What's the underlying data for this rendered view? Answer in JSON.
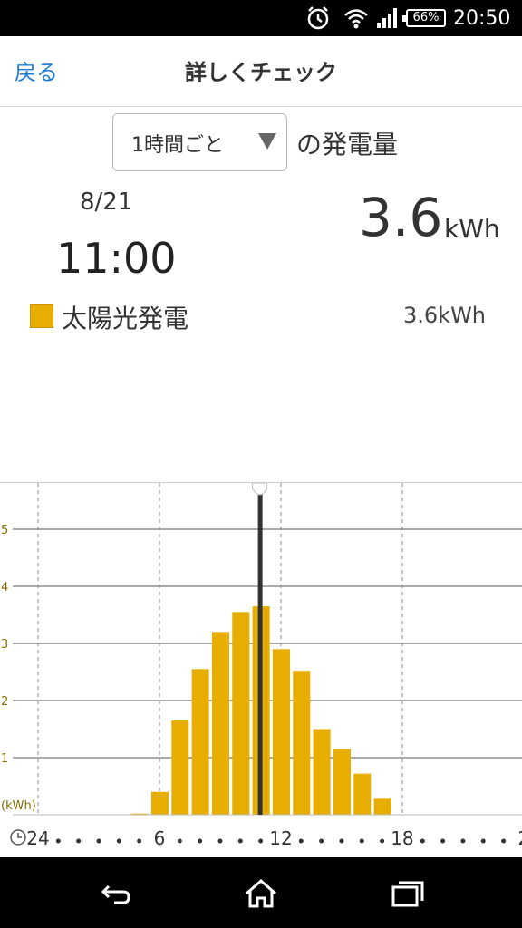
{
  "status_bar": {
    "clock": "20:50",
    "battery": "66%",
    "icons": [
      "alarm-icon",
      "wifi-icon",
      "signal-icon",
      "battery-icon"
    ]
  },
  "app_bar": {
    "back_label": "戻る",
    "title": "詳しくチェック"
  },
  "selector": {
    "selected": "1時間ごと",
    "suffix": "の発電量"
  },
  "summary": {
    "date": "8/21",
    "time": "11:00",
    "total_value": "3.6",
    "total_unit": "kWh",
    "legend_label": "太陽光発電",
    "legend_value": "3.6kWh"
  },
  "colors": {
    "accent": "#1f7ad6",
    "bar": "#e7ad00",
    "ytick": "#8a6d00"
  },
  "chart_data": {
    "type": "bar",
    "ylabel": "(kWh)",
    "ylim": [
      0,
      5.5
    ],
    "yticks": [
      1,
      2,
      3,
      4,
      5
    ],
    "xticks": [
      "24",
      "6",
      "12",
      "18",
      "2"
    ],
    "x": [
      5,
      6,
      7,
      8,
      9,
      10,
      11,
      12,
      13,
      14,
      15,
      16,
      17
    ],
    "values": [
      0.02,
      0.4,
      1.65,
      2.55,
      3.2,
      3.55,
      3.65,
      2.9,
      2.52,
      1.5,
      1.15,
      0.72,
      0.28
    ],
    "selected_hour": 11
  },
  "nav": {
    "back_icon": "back-arrow-icon",
    "home_icon": "home-icon",
    "recents_icon": "recents-icon"
  }
}
